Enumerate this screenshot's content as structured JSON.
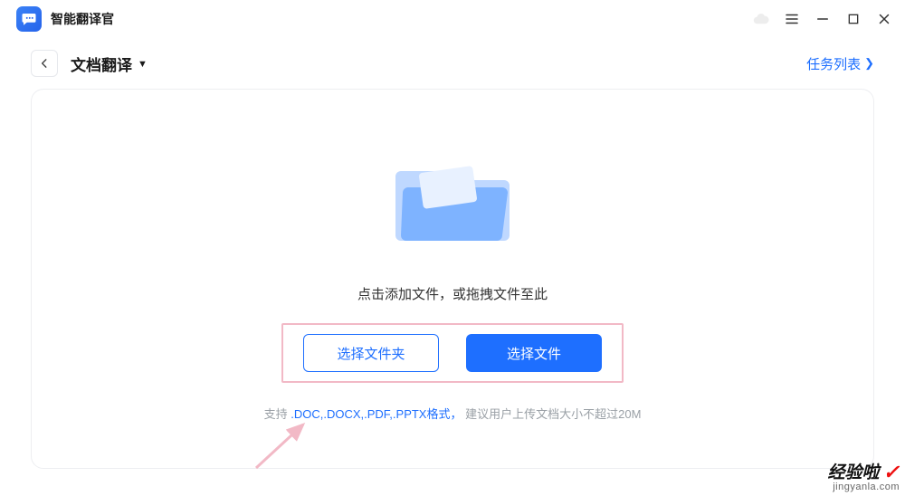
{
  "app": {
    "title": "智能翻译官"
  },
  "windowControls": {
    "cloud": "cloud",
    "menu": "menu",
    "minimize": "minimize",
    "maximize": "maximize",
    "close": "close"
  },
  "subheader": {
    "title": "文档翻译",
    "taskListLabel": "任务列表"
  },
  "main": {
    "hint": "点击添加文件，或拖拽文件至此",
    "selectFolder": "选择文件夹",
    "selectFile": "选择文件",
    "supportPrefix": "支持",
    "supportFormats": ".DOC,.DOCX,.PDF,.PPTX格式，",
    "supportSuffix": "建议用户上传文档大小不超过20M"
  },
  "watermark": {
    "line1": "经验啦",
    "line2": "jingyanla.com"
  }
}
